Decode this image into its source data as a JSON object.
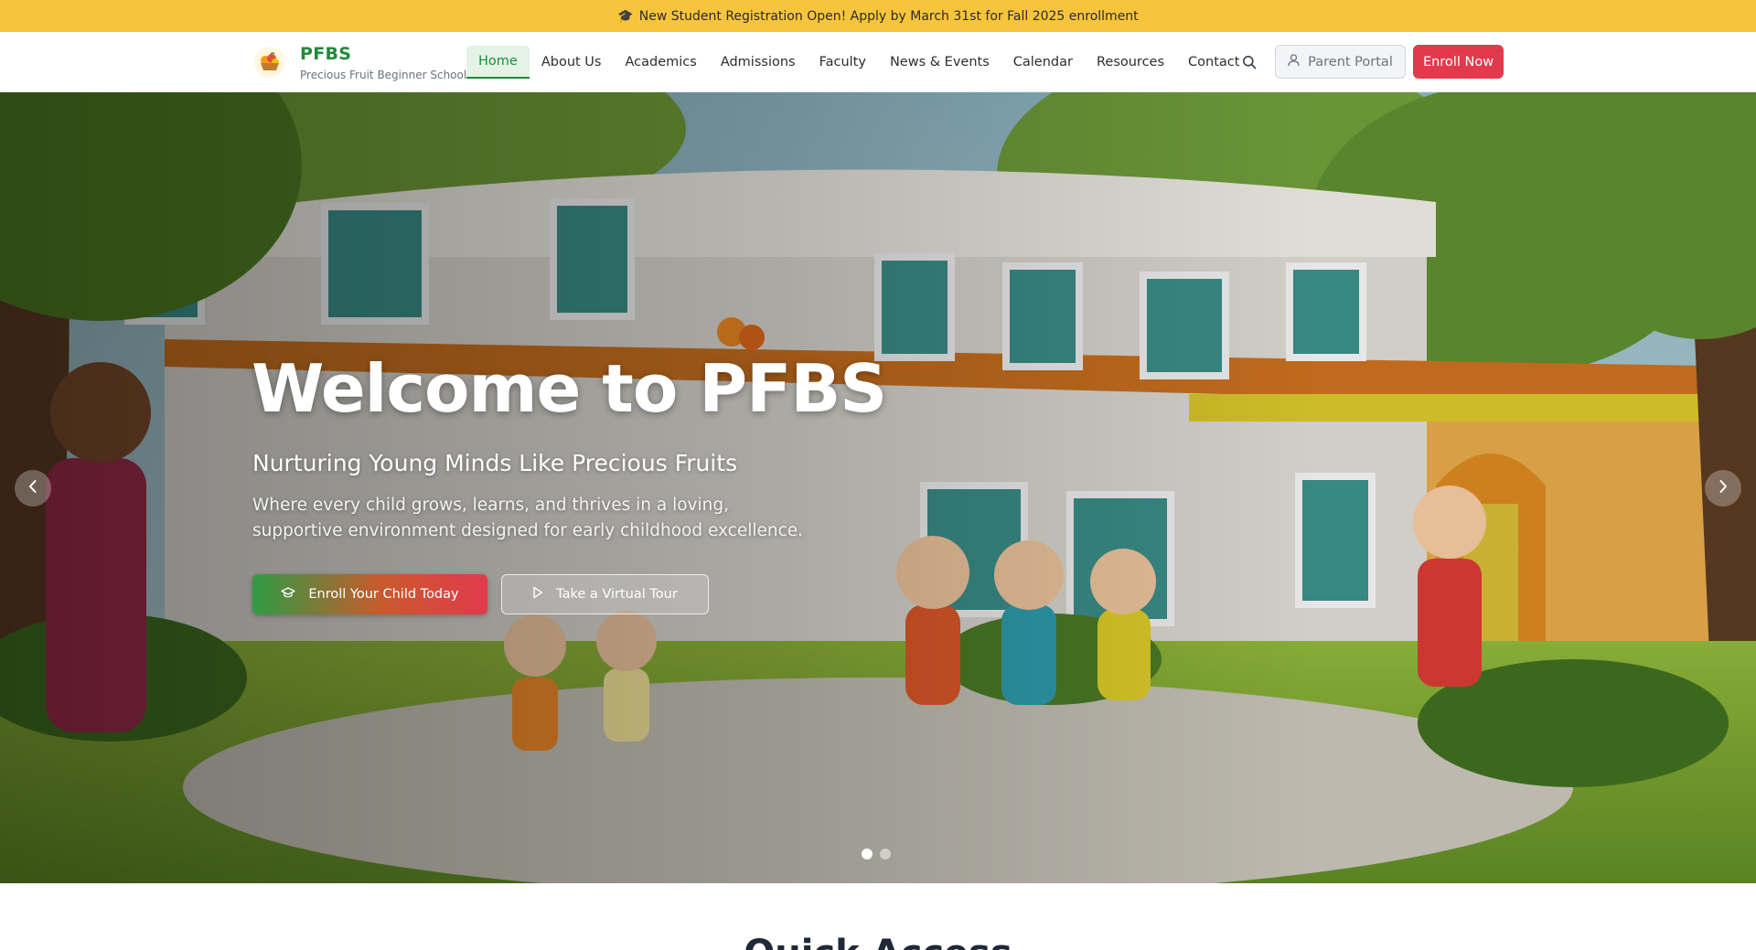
{
  "announcement": {
    "icon": "graduation-cap-icon",
    "text": "New Student Registration Open! Apply by March 31st for Fall 2025 enrollment"
  },
  "brand": {
    "name": "PFBS",
    "full_name": "Precious Fruit Beginner School",
    "logo_icon": "fruit-basket-logo"
  },
  "nav": {
    "items": [
      {
        "label": "Home",
        "active": true
      },
      {
        "label": "About Us"
      },
      {
        "label": "Academics"
      },
      {
        "label": "Admissions"
      },
      {
        "label": "Faculty"
      },
      {
        "label": "News & Events"
      },
      {
        "label": "Calendar"
      },
      {
        "label": "Resources"
      },
      {
        "label": "Contact"
      }
    ],
    "search_icon": "search-icon",
    "portal_label": "Parent Portal",
    "portal_icon": "user-icon",
    "enroll_label": "Enroll Now"
  },
  "hero": {
    "title": "Welcome to PFBS",
    "subtitle": "Nurturing Young Minds Like Precious Fruits",
    "description": "Where every child grows, learns, and thrives in a loving, supportive environment designed for early childhood excellence.",
    "primary_cta": "Enroll Your Child Today",
    "primary_icon": "graduation-cap-icon",
    "secondary_cta": "Take a Virtual Tour",
    "secondary_icon": "play-icon",
    "slides_total": 2,
    "active_slide": 1
  },
  "next_section": {
    "title": "Quick Access"
  },
  "colors": {
    "announcement_bg": "#f7c53b",
    "brand_green": "#1f8a3a",
    "accent_red": "#e23a4c"
  }
}
